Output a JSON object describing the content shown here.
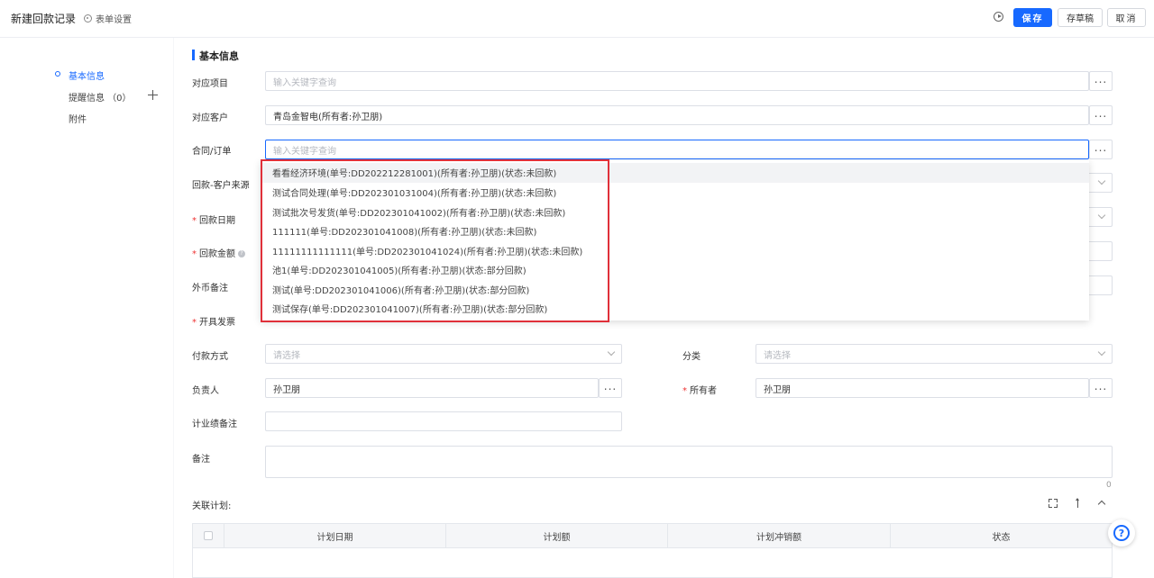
{
  "header": {
    "title": "新建回款记录",
    "form_settings": "表单设置",
    "save": "保存",
    "draft": "存草稿",
    "cancel": "取消"
  },
  "sidenav": {
    "items": [
      {
        "label": "基本信息"
      },
      {
        "label": "提醒信息 （0）"
      },
      {
        "label": "附件"
      }
    ]
  },
  "section": {
    "title": "基本信息"
  },
  "form": {
    "project_label": "对应项目",
    "project_placeholder": "输入关键字查询",
    "customer_label": "对应客户",
    "customer_value": "青岛金智电(所有者:孙卫朋)",
    "contract_label": "合同/订单",
    "contract_placeholder": "输入关键字查询",
    "source_label": "回款-客户来源",
    "date_label": "回款日期",
    "amount_label": "回款金额",
    "currency_label": "外币备注",
    "invoice_label": "开具发票",
    "payment_label": "付款方式",
    "payment_placeholder": "请选择",
    "category_label": "分类",
    "category_placeholder": "请选择",
    "owner_person_label": "负责人",
    "owner_person_value": "孙卫朋",
    "owner_label": "所有者",
    "owner_value": "孙卫朋",
    "perf_label": "计业绩备注",
    "note_label": "备注",
    "note_count": "0"
  },
  "dropdown": {
    "items": [
      "看看经济环境(单号:DD202212281001)(所有者:孙卫朋)(状态:未回款)",
      "测试合同处理(单号:DD202301031004)(所有者:孙卫朋)(状态:未回款)",
      "测试批次号发货(单号:DD202301041002)(所有者:孙卫朋)(状态:未回款)",
      "111111(单号:DD202301041008)(所有者:孙卫朋)(状态:未回款)",
      "11111111111111(单号:DD202301041024)(所有者:孙卫朋)(状态:未回款)",
      "池1(单号:DD202301041005)(所有者:孙卫朋)(状态:部分回款)",
      "测试(单号:DD202301041006)(所有者:孙卫朋)(状态:部分回款)",
      "测试保存(单号:DD202301041007)(所有者:孙卫朋)(状态:部分回款)"
    ]
  },
  "plan": {
    "title": "关联计划:",
    "columns": [
      "计划日期",
      "计划额",
      "计划冲销额",
      "状态"
    ]
  },
  "colors": {
    "accent": "#1769ff",
    "highlight": "#e0303a"
  }
}
